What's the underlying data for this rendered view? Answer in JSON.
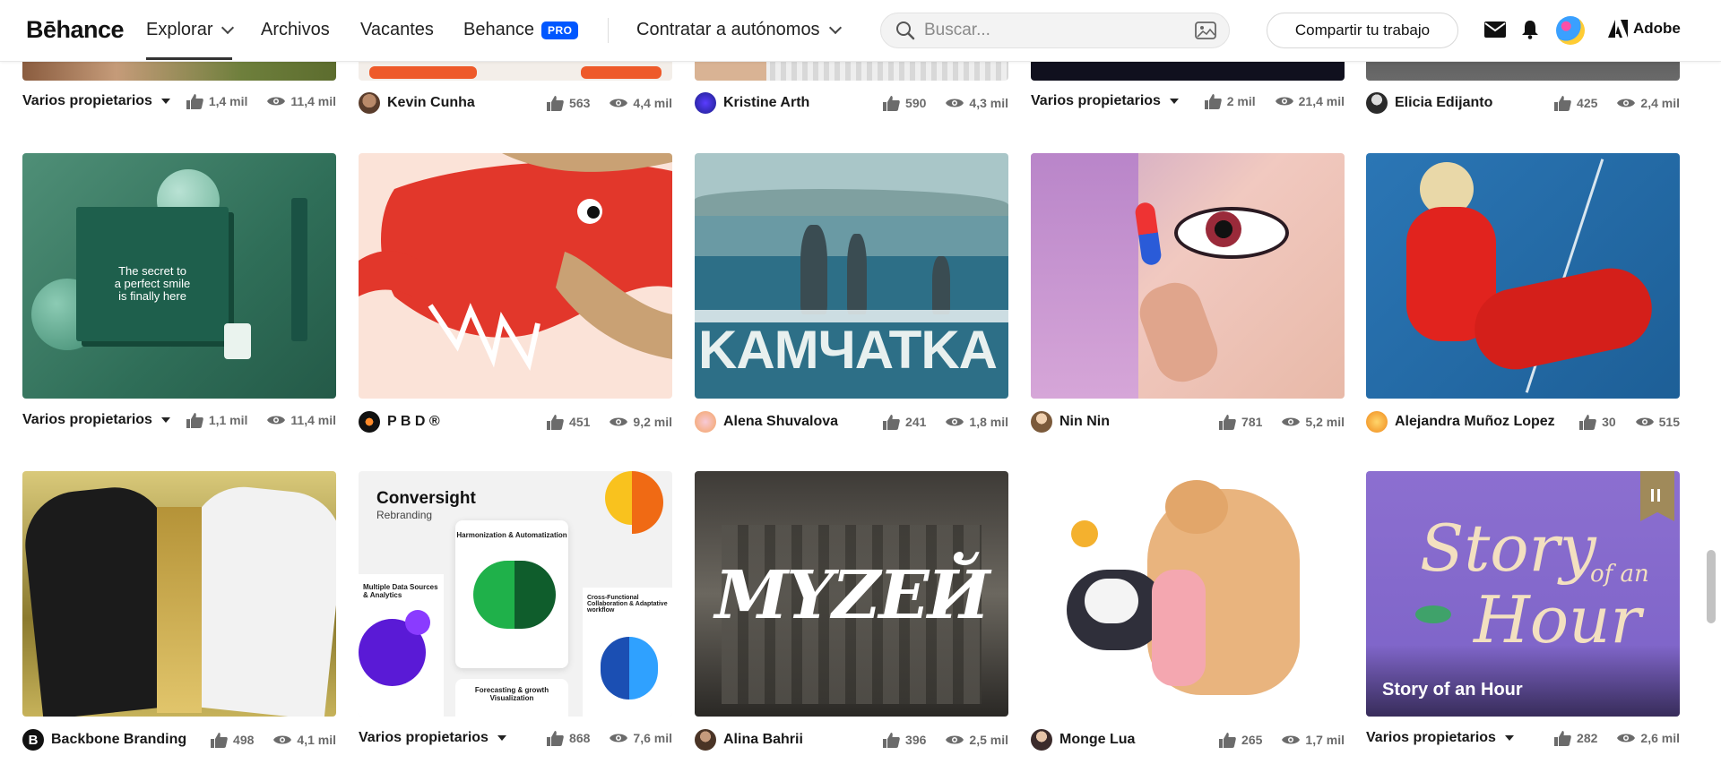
{
  "nav": {
    "logo": "Bēhance",
    "items": [
      {
        "label": "Explorar"
      },
      {
        "label": "Archivos"
      },
      {
        "label": "Vacantes"
      },
      {
        "label": "Behance"
      }
    ],
    "pro_badge": "PRO",
    "hire": "Contratar a autónomos",
    "search_placeholder": "Buscar...",
    "share_button": "Compartir tu trabajo",
    "adobe": "Adobe"
  },
  "rows": [
    [
      {
        "owner": "Varios propietarios",
        "multi": true,
        "likes": "1,4 mil",
        "views": "11,4 mil"
      },
      {
        "owner": "Kevin Cunha",
        "likes": "563",
        "views": "4,4 mil"
      },
      {
        "owner": "Kristine Arth",
        "likes": "590",
        "views": "4,3 mil"
      },
      {
        "owner": "Varios propietarios",
        "multi": true,
        "likes": "2 mil",
        "views": "21,4 mil"
      },
      {
        "owner": "Elicia Edijanto",
        "likes": "425",
        "views": "2,4 mil"
      }
    ],
    [
      {
        "owner": "Varios propietarios",
        "multi": true,
        "likes": "1,1 mil",
        "views": "11,4 mil",
        "art_text": [
          "The secret to",
          "a perfect smile",
          "is finally here"
        ]
      },
      {
        "owner": "P B D ®",
        "likes": "451",
        "views": "9,2 mil"
      },
      {
        "owner": "Alena Shuvalova",
        "likes": "241",
        "views": "1,8 mil",
        "art_text": [
          "KAMЧATKA"
        ]
      },
      {
        "owner": "Nin Nin",
        "likes": "781",
        "views": "5,2 mil"
      },
      {
        "owner": "Alejandra Muñoz Lopez",
        "likes": "30",
        "views": "515"
      }
    ],
    [
      {
        "owner": "Backbone Branding",
        "likes": "498",
        "views": "4,1 mil"
      },
      {
        "owner": "Varios propietarios",
        "multi": true,
        "likes": "868",
        "views": "7,6 mil",
        "art_text": [
          "Conversight",
          "Rebranding",
          "Harmonization & Automatization",
          "Multiple Data Sources & Analytics",
          "Cross-Functional Collaboration & Adaptative workflow",
          "Forecasting & growth Visualization"
        ]
      },
      {
        "owner": "Alina Bahrii",
        "likes": "396",
        "views": "2,5 mil",
        "art_text": [
          "MYZEЙ"
        ]
      },
      {
        "owner": "Monge Lua",
        "likes": "265",
        "views": "1,7 mil"
      },
      {
        "owner": "Varios propietarios",
        "multi": true,
        "likes": "282",
        "views": "2,6 mil",
        "art_text": [
          "Story",
          "of an",
          "Hour"
        ],
        "overlay": "Story of an Hour"
      }
    ]
  ]
}
